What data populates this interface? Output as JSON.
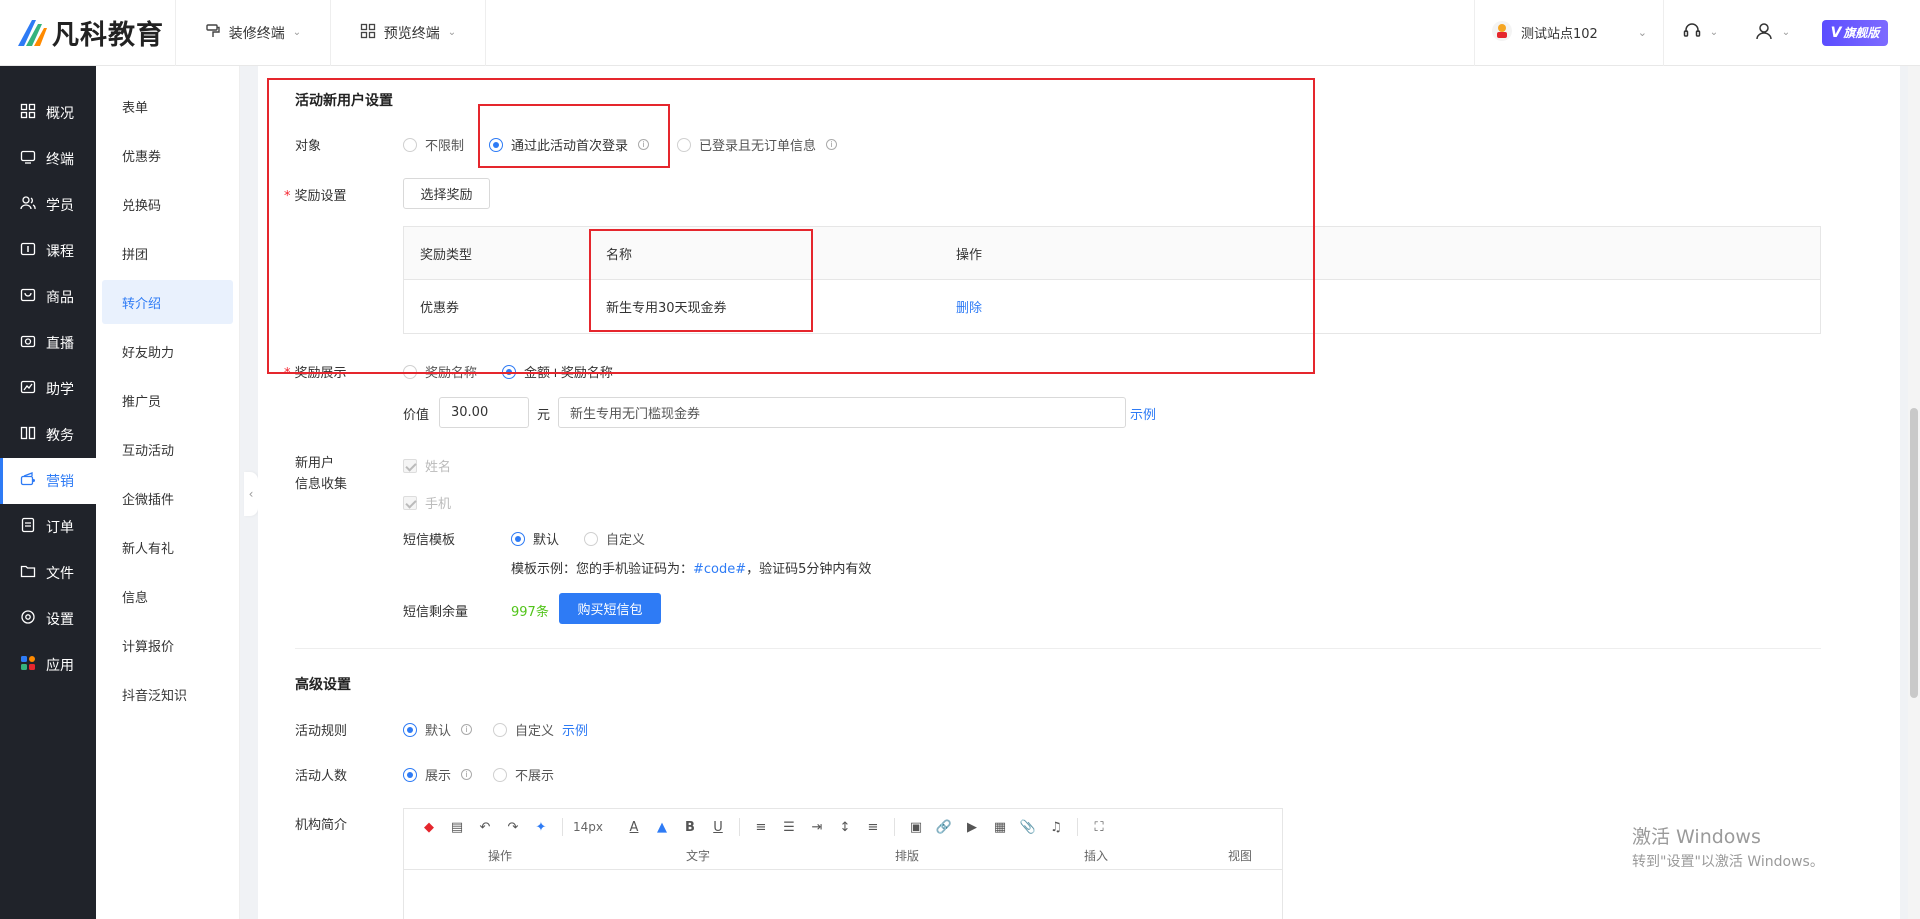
{
  "brand": {
    "name": "凡科教育",
    "edition": "旗舰版"
  },
  "top_nav": [
    {
      "label": "装修终端"
    },
    {
      "label": "预览终端"
    }
  ],
  "site_select": {
    "label": "测试站点102"
  },
  "sidebar": [
    {
      "label": "概况",
      "icon": "grid-icon"
    },
    {
      "label": "终端",
      "icon": "monitor-icon"
    },
    {
      "label": "学员",
      "icon": "users-icon"
    },
    {
      "label": "课程",
      "icon": "course-icon"
    },
    {
      "label": "商品",
      "icon": "bag-icon"
    },
    {
      "label": "直播",
      "icon": "camera-icon"
    },
    {
      "label": "助学",
      "icon": "assist-icon"
    },
    {
      "label": "教务",
      "icon": "book-icon"
    },
    {
      "label": "营销",
      "icon": "megaphone-icon"
    },
    {
      "label": "订单",
      "icon": "order-icon"
    },
    {
      "label": "文件",
      "icon": "folder-icon"
    },
    {
      "label": "设置",
      "icon": "gear-icon"
    },
    {
      "label": "应用",
      "icon": "apps-icon"
    }
  ],
  "submenu": [
    {
      "label": "表单"
    },
    {
      "label": "优惠券"
    },
    {
      "label": "兑换码"
    },
    {
      "label": "拼团"
    },
    {
      "label": "转介绍"
    },
    {
      "label": "好友助力"
    },
    {
      "label": "推广员"
    },
    {
      "label": "互动活动"
    },
    {
      "label": "企微插件"
    },
    {
      "label": "新人有礼"
    },
    {
      "label": "信息"
    },
    {
      "label": "计算报价"
    },
    {
      "label": "抖音泛知识"
    }
  ],
  "new_user": {
    "title": "活动新用户设置",
    "target_label": "对象",
    "target_options": [
      "不限制",
      "通过此活动首次登录",
      "已登录且无订单信息"
    ],
    "reward_label": "奖励设置",
    "choose_reward_btn": "选择奖励",
    "table": {
      "headers": [
        "奖励类型",
        "名称",
        "操作"
      ],
      "rows": [
        {
          "type": "优惠券",
          "name": "新生专用30天现金券",
          "action": "删除"
        }
      ]
    },
    "display_label": "奖励展示",
    "display_options": [
      "奖励名称",
      "金额+奖励名称"
    ],
    "value_label": "价值",
    "value": "30.00",
    "unit": "元",
    "value_text": "新生专用无门槛现金券",
    "example_link": "示例"
  },
  "info_collect": {
    "label_line1": "新用户",
    "label_line2": "信息收集",
    "fields": [
      "姓名",
      "手机"
    ],
    "sms_template_label": "短信模板",
    "sms_template_options": [
      "默认",
      "自定义"
    ],
    "template_example_prefix": "模板示例：您的手机验证码为：",
    "template_example_code": "#code#",
    "template_example_suffix": "，验证码5分钟内有效",
    "sms_remaining_label": "短信剩余量",
    "sms_remaining_value": "997条",
    "buy_sms_btn": "购买短信包"
  },
  "advanced": {
    "title": "高级设置",
    "rules_label": "活动规则",
    "rules_options": [
      "默认",
      "自定义"
    ],
    "rules_example": "示例",
    "count_label": "活动人数",
    "count_options": [
      "展示",
      "不展示"
    ],
    "intro_label": "机构简介"
  },
  "editor": {
    "font_size": "14px",
    "groups": [
      "操作",
      "文字",
      "排版",
      "插入",
      "视图"
    ]
  },
  "watermark": {
    "line1": "激活 Windows",
    "line2": "转到\"设置\"以激活 Windows。"
  },
  "colors": {
    "accent": "#2e7bf5",
    "sidebar_bg": "#20232a",
    "highlight": "#e5262d",
    "success": "#52c41a"
  }
}
